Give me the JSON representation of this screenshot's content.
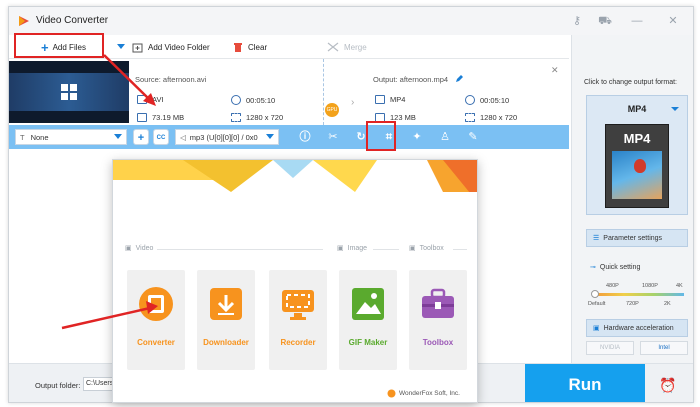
{
  "app": {
    "title": "Video Converter"
  },
  "toolbar": {
    "add_files": "Add Files",
    "add_video_folder": "Add Video Folder",
    "clear": "Clear",
    "merge": "Merge"
  },
  "task": {
    "source_label": "Source: afternoon.avi",
    "source_format": "AVI",
    "source_duration": "00:05:10",
    "source_size": "73.19 MB",
    "source_resolution": "1280 x 720",
    "output_label": "Output: afternoon.mp4",
    "output_format": "MP4",
    "output_duration": "00:05:10",
    "output_size": "123 MB",
    "output_resolution": "1280 x 720",
    "gpu": "GPU"
  },
  "editbar": {
    "subtitle_value": "None",
    "cc": "CC",
    "audio_value": "mp3 (U[0][0][0] / 0x0"
  },
  "bottom": {
    "output_folder_label": "Output folder:",
    "output_folder_value": "C:\\Users\\",
    "run": "Run"
  },
  "right_panel": {
    "hint": "Click to change output format:",
    "format": "MP4",
    "format_card": "MP4",
    "parameter_settings": "Parameter settings",
    "quick_setting": "Quick setting",
    "ticks_top": [
      "480P",
      "1080P",
      "4K"
    ],
    "ticks_bottom": [
      "Default",
      "720P",
      "2K"
    ],
    "quick_setting_level": 0,
    "hardware_acceleration": "Hardware acceleration",
    "gpu_logos": [
      "NVIDIA",
      "Intel"
    ]
  },
  "launcher": {
    "sections": {
      "video": "Video",
      "image": "Image",
      "toolbox": "Toolbox"
    },
    "tiles": [
      {
        "label": "Converter",
        "color": "#f7931e"
      },
      {
        "label": "Downloader",
        "color": "#f7931e"
      },
      {
        "label": "Recorder",
        "color": "#f7931e"
      },
      {
        "label": "GIF Maker",
        "color": "#5aaa2e"
      },
      {
        "label": "Toolbox",
        "color": "#9b59b6"
      }
    ],
    "footer": "WonderFox Soft, Inc."
  }
}
